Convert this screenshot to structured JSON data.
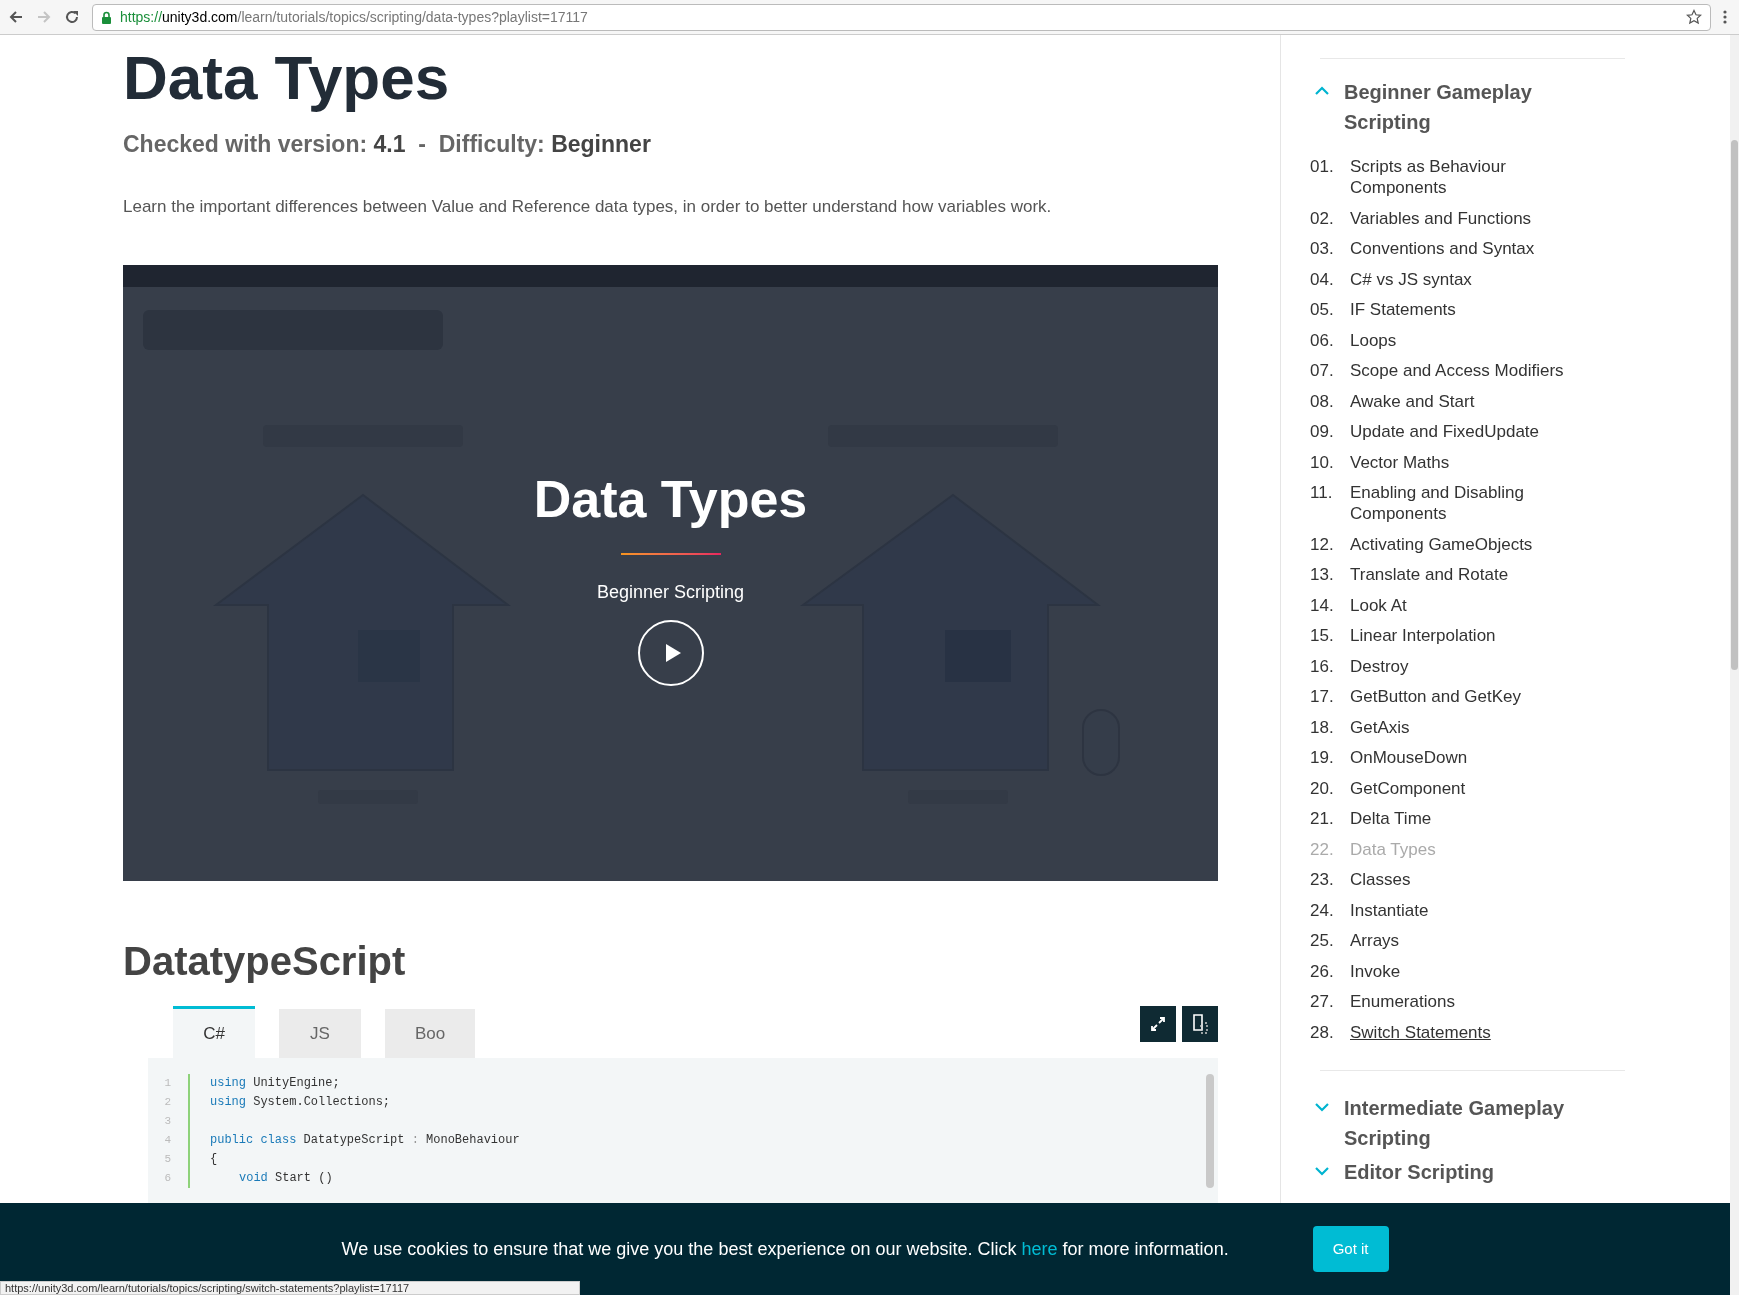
{
  "browser": {
    "url_scheme": "https://",
    "url_host": "unity3d.com",
    "url_path": "/learn/tutorials/topics/scripting/data-types?playlist=17117",
    "forward_disabled": true
  },
  "page": {
    "title": "Data Types",
    "meta": "Checked with version: **4.1**  -  Difficulty: **Beginner**",
    "description": "Learn the important differences between Value and Reference data types, in order to better understand how variables work."
  },
  "video": {
    "kind": "picture",
    "title": "Data Types",
    "subtitle": "Beginner Scripting"
  },
  "script": {
    "title": "DatatypeScript",
    "tabs": [
      {
        "label": "C#",
        "selected": true
      },
      {
        "label": "JS",
        "selected": false
      },
      {
        "label": "Boo",
        "selected": false
      }
    ],
    "lines": [
      {
        "number": "1",
        "tokens": [
          {
            "kind": "keyword",
            "text": "using"
          },
          {
            "kind": "plain",
            "text": " UnityEngine;"
          }
        ]
      },
      {
        "number": "2",
        "tokens": [
          {
            "kind": "keyword",
            "text": "using"
          },
          {
            "kind": "plain",
            "text": " System.Collections;"
          }
        ]
      },
      {
        "number": "3"
      },
      {
        "number": "4",
        "tokens": [
          {
            "kind": "keyword",
            "text": "public class"
          },
          {
            "kind": "plain",
            "text": " DatatypeScript "
          },
          {
            "kind": "operator",
            "text": ":"
          },
          {
            "kind": "plain",
            "text": " MonoBehaviour"
          }
        ]
      },
      {
        "number": "5",
        "tokens": [
          {
            "kind": "plain",
            "text": "{"
          }
        ]
      },
      {
        "number": "6",
        "indent": true,
        "tokens": [
          {
            "kind": "keyword",
            "text": "void"
          },
          {
            "kind": "plain",
            "text": " Start ()"
          }
        ]
      }
    ]
  },
  "sidebar": {
    "sections": [
      {
        "title": "Beginner Gameplay Scripting",
        "expanded": true,
        "items": [
          {
            "number": "01.",
            "label": "Scripts as Behaviour Components",
            "current": false,
            "hovered": false
          },
          {
            "number": "02.",
            "label": "Variables and Functions",
            "current": false,
            "hovered": false
          },
          {
            "number": "03.",
            "label": "Conventions and Syntax",
            "current": false,
            "hovered": false
          },
          {
            "number": "04.",
            "label": "C# vs JS syntax",
            "current": false,
            "hovered": false
          },
          {
            "number": "05.",
            "label": "IF Statements",
            "current": false,
            "hovered": false
          },
          {
            "number": "06.",
            "label": "Loops",
            "current": false,
            "hovered": false
          },
          {
            "number": "07.",
            "label": "Scope and Access Modifiers",
            "current": false,
            "hovered": false
          },
          {
            "number": "08.",
            "label": "Awake and Start",
            "current": false,
            "hovered": false
          },
          {
            "number": "09.",
            "label": "Update and FixedUpdate",
            "current": false,
            "hovered": false
          },
          {
            "number": "10.",
            "label": "Vector Maths",
            "current": false,
            "hovered": false
          },
          {
            "number": "11.",
            "label": "Enabling and Disabling Components",
            "current": false,
            "hovered": false
          },
          {
            "number": "12.",
            "label": "Activating GameObjects",
            "current": false,
            "hovered": false
          },
          {
            "number": "13.",
            "label": "Translate and Rotate",
            "current": false,
            "hovered": false
          },
          {
            "number": "14.",
            "label": "Look At",
            "current": false,
            "hovered": false
          },
          {
            "number": "15.",
            "label": "Linear Interpolation",
            "current": false,
            "hovered": false
          },
          {
            "number": "16.",
            "label": "Destroy",
            "current": false,
            "hovered": false
          },
          {
            "number": "17.",
            "label": "GetButton and GetKey",
            "current": false,
            "hovered": false
          },
          {
            "number": "18.",
            "label": "GetAxis",
            "current": false,
            "hovered": false
          },
          {
            "number": "19.",
            "label": "OnMouseDown",
            "current": false,
            "hovered": false
          },
          {
            "number": "20.",
            "label": "GetComponent",
            "current": false,
            "hovered": false
          },
          {
            "number": "21.",
            "label": "Delta Time",
            "current": false,
            "hovered": false
          },
          {
            "number": "22.",
            "label": "Data Types",
            "current": true,
            "hovered": false
          },
          {
            "number": "23.",
            "label": "Classes",
            "current": false,
            "hovered": false
          },
          {
            "number": "24.",
            "label": "Instantiate",
            "current": false,
            "hovered": false
          },
          {
            "number": "25.",
            "label": "Arrays",
            "current": false,
            "hovered": false
          },
          {
            "number": "26.",
            "label": "Invoke",
            "current": false,
            "hovered": false
          },
          {
            "number": "27.",
            "label": "Enumerations",
            "current": false,
            "hovered": false
          },
          {
            "number": "28.",
            "label": "Switch Statements",
            "current": false,
            "hovered": true
          }
        ]
      },
      {
        "title": "Intermediate Gameplay Scripting",
        "expanded": false
      },
      {
        "title": "Editor Scripting",
        "expanded": false
      }
    ]
  },
  "cookie_bar": {
    "message_before": "We use cookies to ensure that we give you the best experience on our website. Click ",
    "link": "here",
    "message_after": " for more information.",
    "button": "Got it"
  },
  "status_url": "https://unity3d.com/learn/tutorials/topics/scripting/switch-statements?playlist=17117"
}
